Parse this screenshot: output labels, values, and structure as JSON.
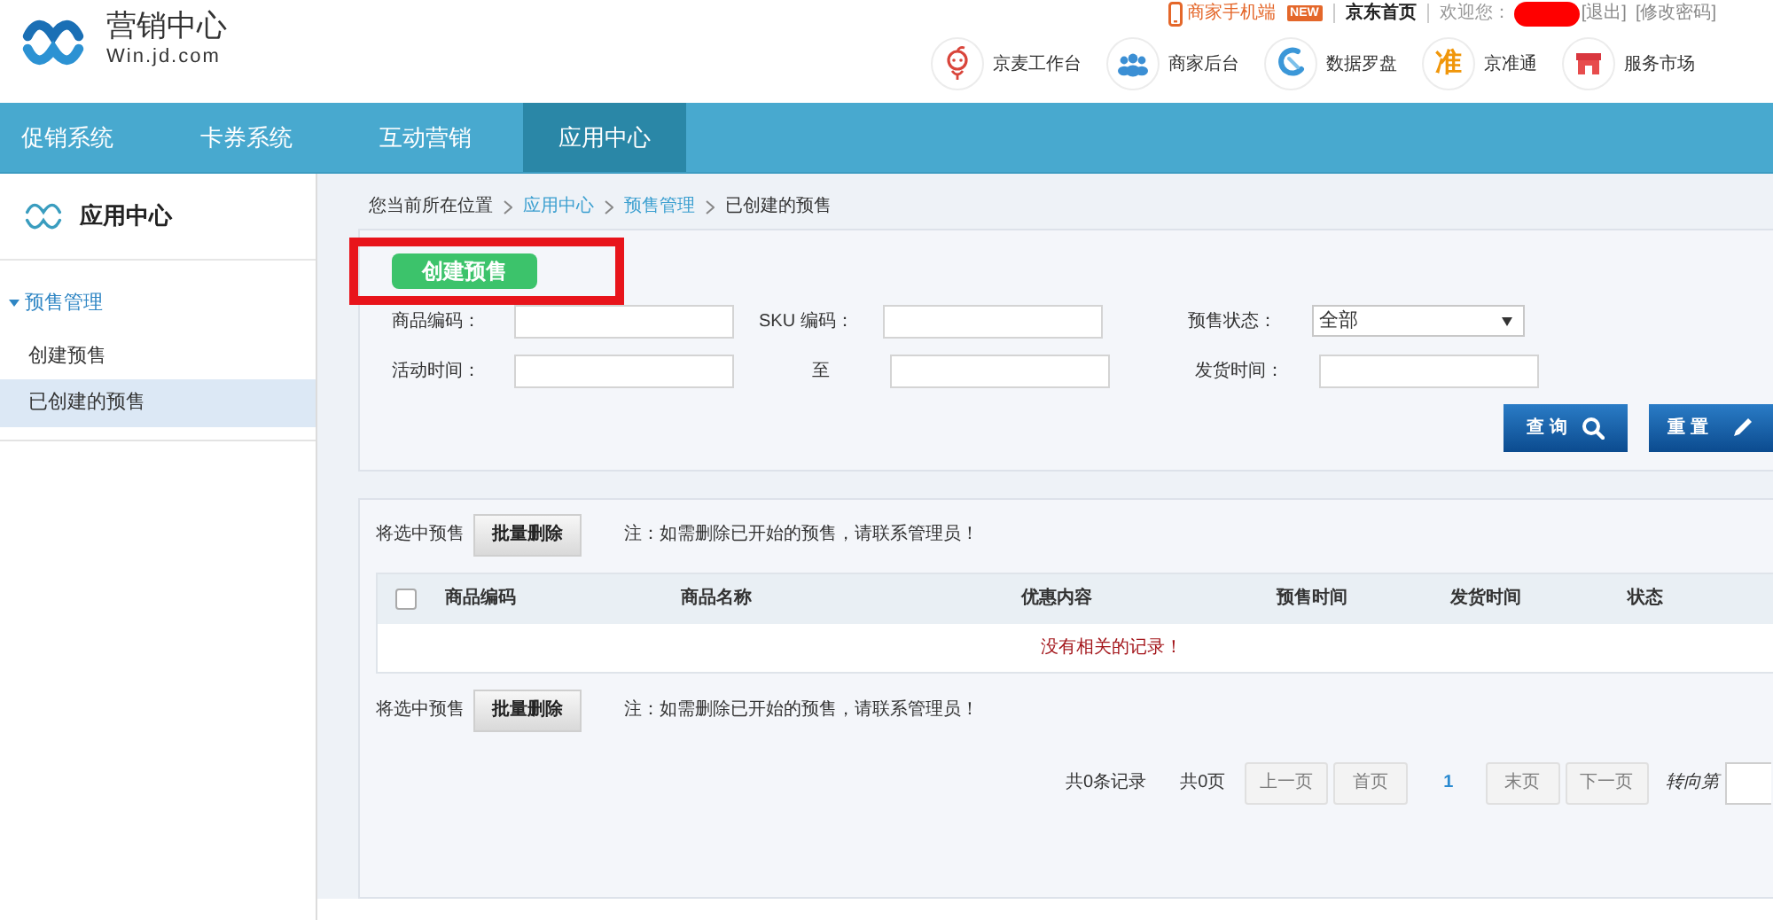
{
  "header": {
    "logo_title": "营销中心",
    "logo_subtitle": "Win.jd.com"
  },
  "top_bar": {
    "mobile_link": "商家手机端",
    "badge": "NEW",
    "home_link": "京东首页",
    "welcome": "欢迎您：",
    "name_redacted": true,
    "logout": "[退出]",
    "change_password": "[修改密码]"
  },
  "quick_links": [
    {
      "kind": "face",
      "label": "京麦工作台"
    },
    {
      "kind": "people",
      "label": "商家后台"
    },
    {
      "kind": "swirl",
      "label": "数据罗盘"
    },
    {
      "kind": "char",
      "icon_char": "准",
      "label": "京准通"
    },
    {
      "kind": "shop",
      "label": "服务市场"
    }
  ],
  "nav": [
    {
      "label": "促销系统",
      "selected": false
    },
    {
      "label": "卡券系统",
      "selected": false
    },
    {
      "label": "互动营销",
      "selected": false
    },
    {
      "label": "应用中心",
      "selected": true
    }
  ],
  "sidebar": {
    "title": "应用中心",
    "groups": [
      {
        "label": "预售管理",
        "expanded": true,
        "items": [
          {
            "label": "创建预售",
            "selected": false
          },
          {
            "label": "已创建的预售",
            "selected": true
          }
        ]
      }
    ]
  },
  "breadcrumb": {
    "prefix": "您当前所在位置",
    "items": [
      {
        "label": "应用中心",
        "link": true
      },
      {
        "label": "预售管理",
        "link": true
      },
      {
        "label": "已创建的预售",
        "link": false
      }
    ]
  },
  "search_panel": {
    "create_button": {
      "label": "创建预售",
      "highlighted": true
    },
    "filter_rows": [
      [
        {
          "kind": "input",
          "label": "商品编码："
        },
        {
          "kind": "input",
          "label": "SKU 编码："
        },
        {
          "kind": "select",
          "label": "预售状态：",
          "value": "全部"
        }
      ],
      [
        {
          "kind": "input",
          "label": "活动时间："
        },
        {
          "kind": "range_to",
          "label": "至"
        },
        {
          "kind": "input",
          "label": "发货时间："
        }
      ]
    ],
    "actions": [
      {
        "kind": "search",
        "label": "查 询"
      },
      {
        "kind": "reset",
        "label": "重 置"
      }
    ]
  },
  "results": {
    "bulk_bar_top": {
      "label": "将选中预售",
      "button": "批量删除",
      "note": "注：如需删除已开始的预售，请联系管理员！"
    },
    "table": {
      "select_all_checked": false,
      "columns": [
        "商品编码",
        "商品名称",
        "优惠内容",
        "预售时间",
        "发货时间",
        "状态"
      ],
      "empty_message": "没有相关的记录！"
    },
    "bulk_bar_bottom": {
      "label": "将选中预售",
      "button": "批量删除",
      "note": "注：如需删除已开始的预售，请联系管理员！"
    },
    "pagination": {
      "total_records": "共0条记录",
      "total_pages": "共0页",
      "before_pages": [
        {
          "label": "上一页",
          "disabled": true
        },
        {
          "label": "首页",
          "disabled": true
        }
      ],
      "pages": [
        {
          "label": "1",
          "selected": true
        }
      ],
      "after_pages": [
        {
          "label": "末页",
          "disabled": true
        },
        {
          "label": "下一页",
          "disabled": true
        }
      ],
      "goto_label": "转向第"
    }
  }
}
